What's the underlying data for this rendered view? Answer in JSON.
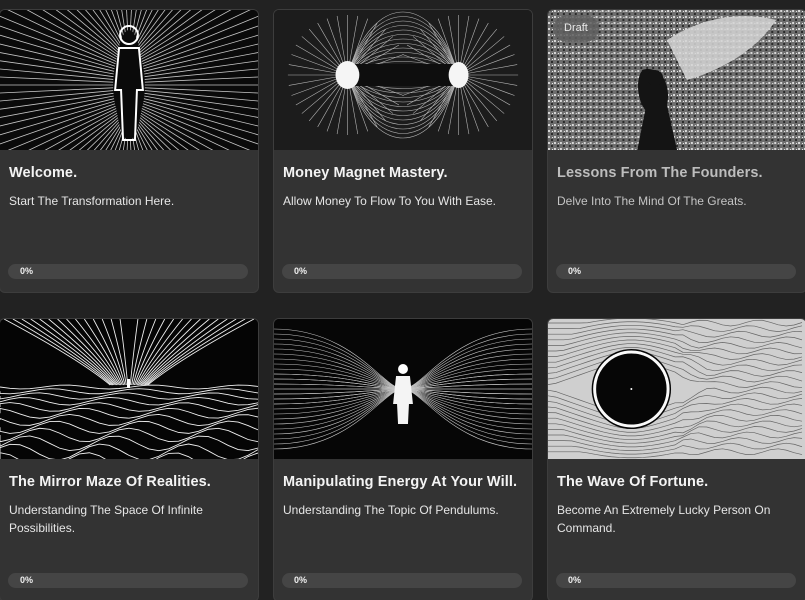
{
  "courses": [
    {
      "title": "Welcome.",
      "description": "Start The Transformation Here.",
      "progress_label": "0%",
      "progress": 0,
      "image_icon": "figure-energy-field-image"
    },
    {
      "title": "Money Magnet Mastery.",
      "description": "Allow Money To Flow To You With Ease.",
      "progress_label": "0%",
      "progress": 0,
      "image_icon": "magnetic-field-image"
    },
    {
      "title": "Lessons From The Founders.",
      "description": "Delve Into The Mind Of The Greats.",
      "progress_label": "0%",
      "progress": 0,
      "badge": "Draft",
      "image_icon": "winged-statue-image"
    },
    {
      "title": "The Mirror Maze Of Realities.",
      "description": "Understanding The Space Of Infinite Possibilities.",
      "progress_label": "0%",
      "progress": 0,
      "image_icon": "wave-landscape-image"
    },
    {
      "title": "Manipulating Energy At Your Will.",
      "description": "Understanding The Topic Of Pendulums.",
      "progress_label": "0%",
      "progress": 0,
      "image_icon": "energy-mesh-figure-image"
    },
    {
      "title": "The Wave Of Fortune.",
      "description": "Become An Extremely Lucky Person On Command.",
      "progress_label": "0%",
      "progress": 0,
      "image_icon": "black-hole-flow-image"
    }
  ],
  "colors": {
    "background": "#222222",
    "card": "#333333",
    "progress_track": "#454545"
  }
}
